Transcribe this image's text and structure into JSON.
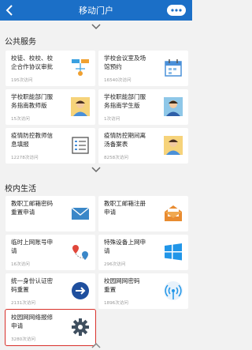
{
  "header": {
    "title": "移动门户"
  },
  "sections": {
    "public": {
      "title": "公共服务",
      "cards": [
        {
          "name": "校徒、校校、校\n企合作协议审批",
          "visits": "195次访问",
          "icon": "flow-diagram-icon"
        },
        {
          "name": "学校会议室及场\n馆预约",
          "visits": "16540次访问",
          "icon": "calendar-icon"
        },
        {
          "name": "学校职能部门服\n务指南教师版",
          "visits": "15次访问",
          "icon": "teacher-avatar-icon"
        },
        {
          "name": "学校职能部门服\n务指南学生版",
          "visits": "1次访问",
          "icon": "student-avatar-icon"
        },
        {
          "name": "疫情防控教师信\n息填报",
          "visits": "12278次访问",
          "icon": "document-icon"
        },
        {
          "name": "疫情防控期间离\n汤备案表",
          "visits": "8258次访问",
          "icon": "teacher-avatar-icon"
        }
      ]
    },
    "campus": {
      "title": "校内生活",
      "cards": [
        {
          "name": "教职工邮箱密码\n重置申请",
          "visits": "",
          "icon": "mail-icon"
        },
        {
          "name": "教职工邮箱注册\n申请",
          "visits": "",
          "icon": "mail-open-icon"
        },
        {
          "name": "临时上网账号申\n请",
          "visits": "16次访问",
          "icon": "map-pin-icon"
        },
        {
          "name": "特殊设备上网申\n请",
          "visits": "296次访问",
          "icon": "windows-icon"
        },
        {
          "name": "统一身份认证密\n码重置",
          "visits": "2131次访问",
          "icon": "arrow-circle-icon"
        },
        {
          "name": "校园网网密码\n重置",
          "visits": "1896次访问",
          "icon": "wireless-icon"
        },
        {
          "name": "校园网网络报修\n申请",
          "visits": "3280次访问",
          "icon": "gear-icon"
        }
      ]
    }
  }
}
